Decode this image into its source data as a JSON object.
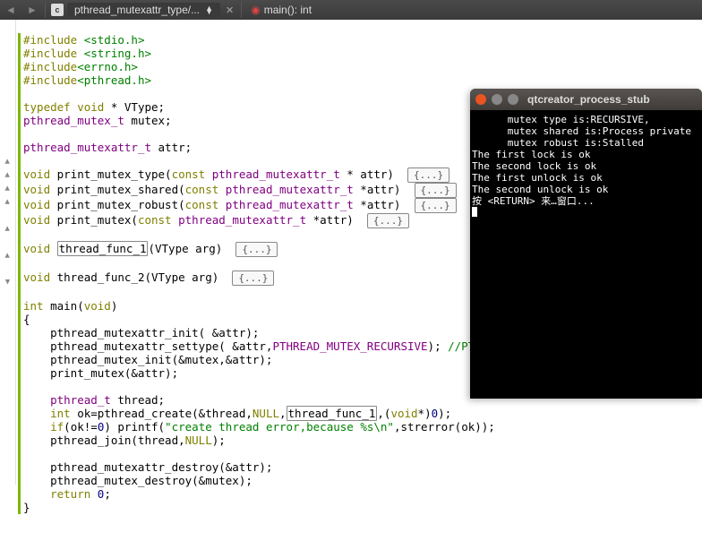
{
  "topbar": {
    "file_icon": "c",
    "dropdown_label": "pthread_mutexattr_type/...",
    "close_x": "✕",
    "crumb_icon": "●",
    "crumb_label": "main(): int"
  },
  "code": {
    "inc1_pre": "#include ",
    "inc1_hdr": "<stdio.h>",
    "inc2_pre": "#include ",
    "inc2_hdr": "<string.h>",
    "inc3_pre": "#include",
    "inc3_hdr": "<errno.h>",
    "inc4_pre": "#include",
    "inc4_hdr": "<pthread.h>",
    "typedef_kw": "typedef",
    "typedef_void": "void",
    "typedef_rest": " * VType;",
    "mutex_decl_type": "pthread_mutex_t",
    "mutex_decl_name": " mutex;",
    "attr_decl_type": "pthread_mutexattr_t",
    "attr_decl_name": " attr;",
    "fn1_void": "void",
    "fn1_name": " print_mutex_type(",
    "fn1_const": "const",
    "fn1_argtype": " pthread_mutexattr_t",
    "fn1_rest": " * attr) ",
    "fn2_void": "void",
    "fn2_name": " print_mutex_shared(",
    "fn2_const": "const",
    "fn2_argtype": " pthread_mutexattr_t",
    "fn2_rest": " *attr) ",
    "fn3_void": "void",
    "fn3_name": " print_mutex_robust(",
    "fn3_const": "const",
    "fn3_argtype": " pthread_mutexattr_t",
    "fn3_rest": " *attr) ",
    "fn4_void": "void",
    "fn4_name": " print_mutex(",
    "fn4_const": "const",
    "fn4_argtype": " pthread_mutexattr_t",
    "fn4_rest": " *attr) ",
    "tf1_void": "void",
    "tf1_name": "thread_func_1",
    "tf1_args": "(VType arg) ",
    "tf2_void": "void",
    "tf2_name": " thread_func_2(VType arg) ",
    "main_int": "int",
    "main_name": " main(",
    "main_void": "void",
    "main_close": ")",
    "brace_open": "{",
    "brace_close": "}",
    "m1": "    pthread_mutexattr_init( &attr);",
    "m2a": "    pthread_mutexattr_settype( &attr,",
    "m2b": "PTHREAD_MUTEX_RECURSIVE",
    "m2c": "); ",
    "m2d": "//PTHRE",
    "m3": "    pthread_mutex_init(&mutex,&attr);",
    "m4": "    print_mutex(&attr);",
    "m5_type": "    pthread_t",
    "m5_rest": " thread;",
    "m6a": "    ",
    "m6_int": "int",
    "m6b": " ok=pthread_create(&thread,",
    "m6_null1": "NULL",
    "m6c": ",",
    "m6_fn": "thread_func_1",
    "m6d": ",(",
    "m6_void": "void",
    "m6e": "*)",
    "m6_zero": "0",
    "m6f": ");",
    "m7a": "    ",
    "m7_if": "if",
    "m7b": "(ok!=",
    "m7_zero": "0",
    "m7c": ") printf(",
    "m7_str": "\"create thread error,because %s\\n\"",
    "m7d": ",strerror(ok));",
    "m8a": "    pthread_join(thread,",
    "m8_null": "NULL",
    "m8b": ");",
    "m9": "    pthread_mutexattr_destroy(&attr);",
    "m10": "    pthread_mutex_destroy(&mutex);",
    "m11a": "    ",
    "m11_ret": "return",
    "m11b": " ",
    "m11_zero": "0",
    "m11c": ";",
    "fold_label": "{...}"
  },
  "terminal": {
    "title": "qtcreator_process_stub",
    "l1": "      mutex type is:RECURSIVE,",
    "l2": "      mutex shared is:Process private",
    "l3": "      mutex robust is:Stalled",
    "l4": "The first lock is ok",
    "l5": "The second lock is ok",
    "l6": "The first unlock is ok",
    "l7": "The second unlock is ok",
    "l8": "按 <RETURN> 来…窗口..."
  }
}
